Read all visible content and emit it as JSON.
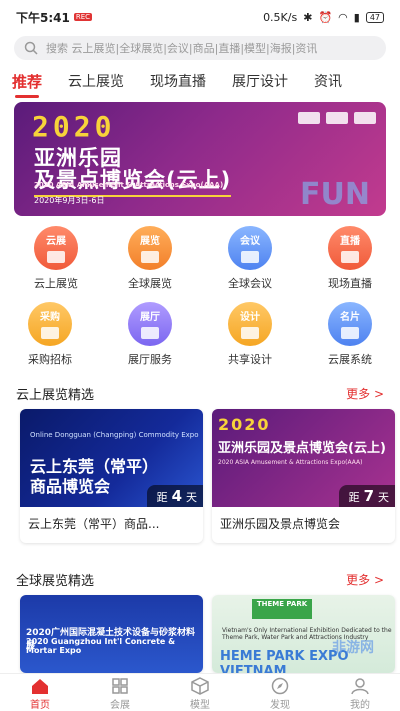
{
  "status": {
    "time": "下午5:41",
    "rec": "REC",
    "speed": "0.5K/s",
    "battery": "47"
  },
  "search": {
    "placeholder": "搜索 云上展览|全球展览|会议|商品|直播|模型|海报|资讯"
  },
  "tabs": [
    "推荐",
    "云上展览",
    "现场直播",
    "展厅设计",
    "资讯"
  ],
  "banner": {
    "year": "2020",
    "title_line1": "亚洲乐园",
    "title_line2": "及景点博览会(云上)",
    "subtitle": "2020 ASIA Amusement & Attractions Expo(AAA)",
    "date": "2020年9月3日-6日",
    "deco": "FUN"
  },
  "grid": [
    {
      "icon_text": "云展",
      "label": "云上展览",
      "color": "red",
      "icon": "cloud-expo-icon"
    },
    {
      "icon_text": "展览",
      "label": "全球展览",
      "color": "orange",
      "icon": "global-expo-icon"
    },
    {
      "icon_text": "会议",
      "label": "全球会议",
      "color": "blue",
      "icon": "meeting-icon"
    },
    {
      "icon_text": "直播",
      "label": "现场直播",
      "color": "red",
      "icon": "live-icon"
    },
    {
      "icon_text": "采购",
      "label": "采购招标",
      "color": "yellow",
      "icon": "purchase-icon"
    },
    {
      "icon_text": "展厅",
      "label": "展厅服务",
      "color": "purple",
      "icon": "hall-icon"
    },
    {
      "icon_text": "设计",
      "label": "共享设计",
      "color": "yellow",
      "icon": "design-icon"
    },
    {
      "icon_text": "名片",
      "label": "云展系统",
      "color": "blue",
      "icon": "card-icon"
    }
  ],
  "section1": {
    "title": "云上展览精选",
    "more": "更多 >",
    "cards": [
      {
        "img_sub": "Online Dongguan (Changping) Commodity Expo",
        "img_line1": "云上东莞（常平）",
        "img_line2": "商品博览会",
        "dist_prefix": "距",
        "dist_num": "4",
        "dist_unit": "天",
        "name": "云上东莞（常平）商品..."
      },
      {
        "img_year": "2020",
        "img_line1": "亚洲乐园及景点博览会(云上)",
        "img_sub": "2020 ASIA Amusement & Attractions Expo(AAA)",
        "dist_prefix": "距",
        "dist_num": "7",
        "dist_unit": "天",
        "name": "亚洲乐园及景点博览会"
      }
    ]
  },
  "section2": {
    "title": "全球展览精选",
    "more": "更多 >",
    "cards": [
      {
        "img_line1": "2020广州国际混凝土技术设备与砂浆材料展",
        "img_line2": "2020 Guangzhou Int'l Concrete & Mortar Expo"
      },
      {
        "img_logo": "THEME PARK",
        "img_sub": "Vietnam's Only International Exhibition Dedicated to the Theme Park, Water Park and Attractions Industry",
        "img_line1": "HEME PARK EXPO VIETNAM"
      }
    ]
  },
  "watermark": "非游网",
  "nav": [
    {
      "label": "首页",
      "icon": "home-icon",
      "active": true
    },
    {
      "label": "会展",
      "icon": "expo-grid-icon",
      "active": false
    },
    {
      "label": "模型",
      "icon": "model-cube-icon",
      "active": false
    },
    {
      "label": "发现",
      "icon": "discover-icon",
      "active": false
    },
    {
      "label": "我的",
      "icon": "profile-icon",
      "active": false
    }
  ]
}
